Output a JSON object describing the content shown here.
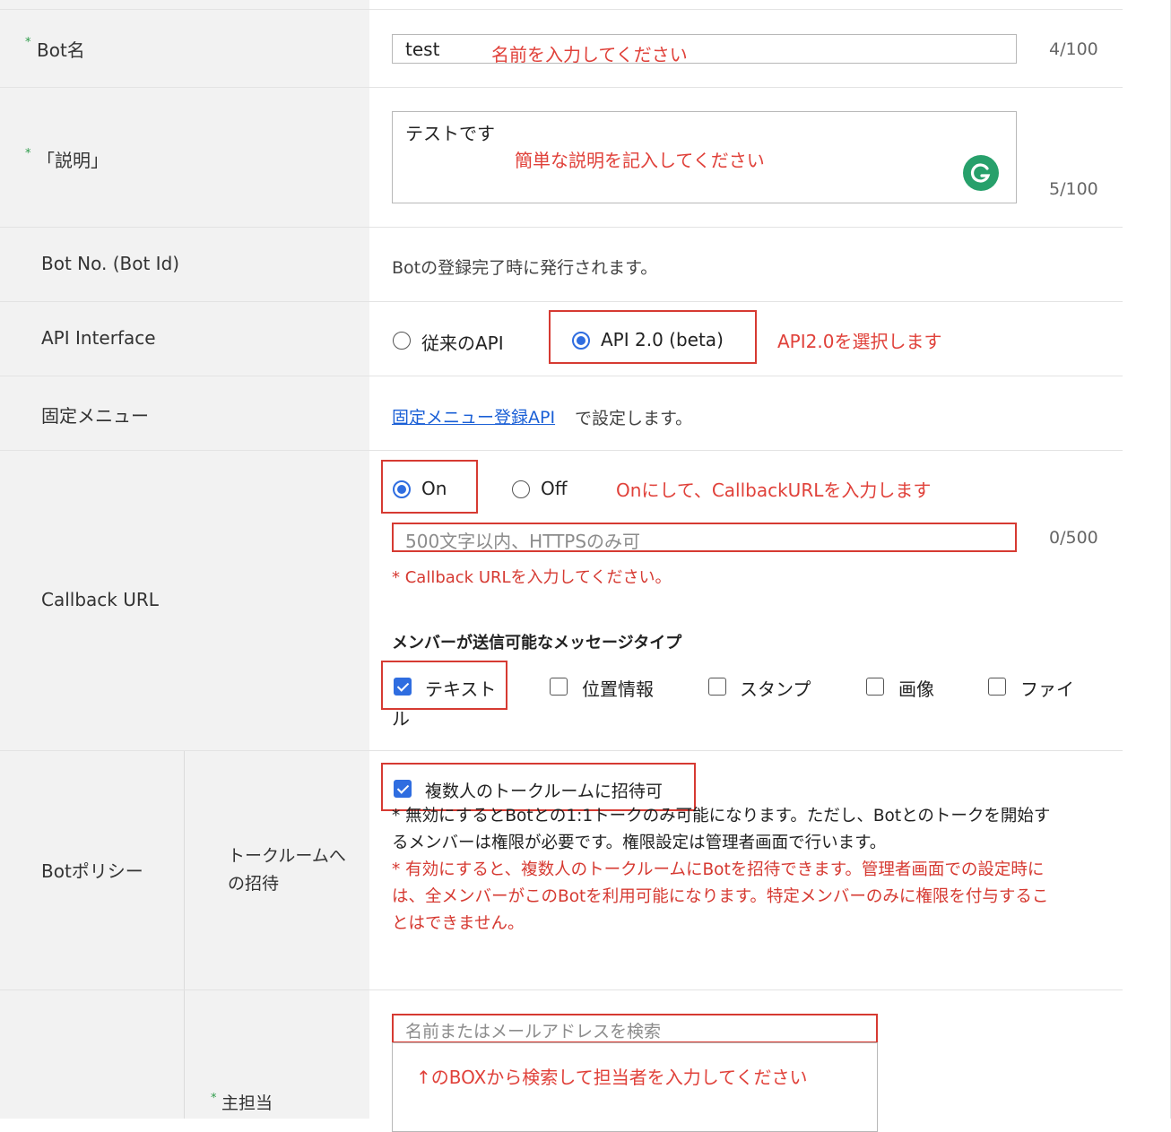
{
  "bot_name": {
    "label": "Bot名",
    "required_mark": "*",
    "value": "test",
    "annotation": "名前を入力してください",
    "counter": "4/100"
  },
  "description": {
    "label": "「説明」",
    "required_mark": "*",
    "value": "テストです",
    "annotation": "簡単な説明を記入してください",
    "counter": "5/100"
  },
  "bot_no": {
    "label": "Bot No. (Bot Id)",
    "text": "Botの登録完了時に発行されます。"
  },
  "api_interface": {
    "label": "API Interface",
    "options": [
      {
        "label": "従来のAPI",
        "selected": false
      },
      {
        "label": "API 2.0 (beta)",
        "selected": true
      }
    ],
    "annotation": "API2.0を選択します"
  },
  "fixed_menu": {
    "label": "固定メニュー",
    "link_text": "固定メニュー登録API",
    "suffix": "で設定します。"
  },
  "callback": {
    "label": "Callback URL",
    "options": [
      {
        "label": "On",
        "selected": true
      },
      {
        "label": "Off",
        "selected": false
      }
    ],
    "annotation": "Onにして、CallbackURLを入力します",
    "placeholder": "500文字以内、HTTPSのみ可",
    "counter": "0/500",
    "error": "* Callback URLを入力してください。",
    "message_types_heading": "メンバーが送信可能なメッセージタイプ",
    "message_types": [
      {
        "label": "テキスト",
        "checked": true
      },
      {
        "label": "位置情報",
        "checked": false
      },
      {
        "label": "スタンプ",
        "checked": false
      },
      {
        "label": "画像",
        "checked": false
      },
      {
        "label": "ファイ",
        "checked": false
      }
    ],
    "wrap_char": "ル"
  },
  "bot_policy": {
    "label": "Botポリシー",
    "sub_label_line1": "トークルームへ",
    "sub_label_line2": "の招待",
    "checkbox_label": "複数人のトークルームに招待可",
    "checkbox_checked": true,
    "note_line1": "* 無効にするとBotとの1:1トークのみ可能になります。ただし、Botとのトークを開始す",
    "note_line2": "るメンバーは権限が必要です。権限設定は管理者画面で行います。",
    "red_note_line1": "* 有効にすると、複数人のトークルームにBotを招待できます。管理者画面での設定時に",
    "red_note_line2": "は、全メンバーがこのBotを利用可能になります。特定メンバーのみに権限を付与するこ",
    "red_note_line3": "とはできません。"
  },
  "main_owner": {
    "label": "主担当",
    "required_mark": "*",
    "search_placeholder": "名前またはメールアドレスを検索",
    "annotation": "↑のBOXから検索して担当者を入力してください"
  },
  "colors": {
    "annotation_red": "#e0413a",
    "selected_blue": "#2f6de0",
    "required_green": "#2e9c4a",
    "label_bg": "#f2f2f2",
    "grammarly_green": "#27a06b"
  }
}
